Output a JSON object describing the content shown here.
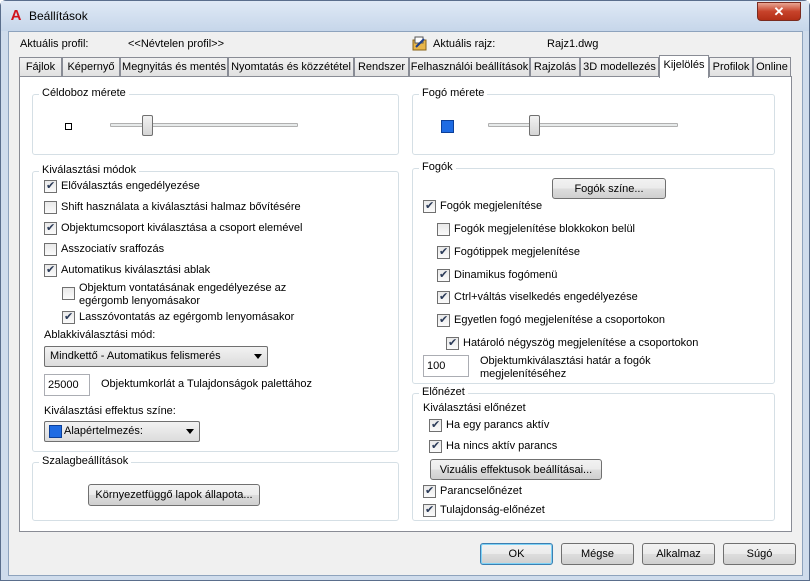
{
  "window": {
    "title": "Beállítások",
    "close_glyph": "✕",
    "app_icon_letter": "A"
  },
  "profile": {
    "label": "Aktuális profil:",
    "value": "<<Névtelen profil>>"
  },
  "drawing": {
    "label": "Aktuális rajz:",
    "value": "Rajz1.dwg"
  },
  "tabs": [
    "Fájlok",
    "Képernyő",
    "Megnyitás és mentés",
    "Nyomtatás és közzététel",
    "Rendszer",
    "Felhasználói beállítások",
    "Rajzolás",
    "3D modellezés",
    "Kijelölés",
    "Profilok",
    "Online"
  ],
  "pickbox": {
    "title": "Céldoboz mérete",
    "slider_value": 0.18
  },
  "grip_size": {
    "title": "Fogó mérete",
    "slider_value": 0.23,
    "color": "#1e6be3"
  },
  "selection_modes": {
    "title": "Kiválasztási módok",
    "items": [
      {
        "label": "Előválasztás engedélyezése",
        "checked": true
      },
      {
        "label": "Shift használata a kiválasztási halmaz bővítésére",
        "checked": false
      },
      {
        "label": "Objektumcsoport kiválasztása a csoport elemével",
        "checked": true
      },
      {
        "label": "Asszociatív sraffozás",
        "checked": false
      },
      {
        "label": "Automatikus kiválasztási ablak",
        "checked": true
      }
    ],
    "sub_items": [
      {
        "label_line1": "Objektum vontatásának engedélyezése az",
        "label_line2": "egérgomb lenyomásakor",
        "checked": false
      },
      {
        "label": "Lasszóvontatás az egérgomb lenyomásakor",
        "checked": true
      }
    ],
    "window_method_label": "Ablakkiválasztási mód:",
    "window_method_value": "Mindkettő - Automatikus felismerés",
    "object_limit_value": "25000",
    "object_limit_label": "Objektumkorlát a Tulajdonságok palettához",
    "effect_color_label": "Kiválasztási effektus színe:",
    "effect_color_value": "Alapértelmezés:",
    "effect_color_swatch": "#1e6be3"
  },
  "ribbon": {
    "title": "Szalagbeállítások",
    "button": "Környezetfüggő lapok állapota..."
  },
  "grips": {
    "title": "Fogók",
    "color_button": "Fogók színe...",
    "items": [
      {
        "label": "Fogók megjelenítése",
        "checked": true,
        "level": 0
      },
      {
        "label": "Fogók megjelenítése blokkokon belül",
        "checked": false,
        "level": 1
      },
      {
        "label": "Fogótippek megjelenítése",
        "checked": true,
        "level": 1
      },
      {
        "label": "Dinamikus fogómenü",
        "checked": true,
        "level": 1
      },
      {
        "label": "Ctrl+váltás viselkedés engedélyezése",
        "checked": true,
        "level": 1
      },
      {
        "label": "Egyetlen fogó megjelenítése a csoportokon",
        "checked": true,
        "level": 1
      },
      {
        "label": "Határoló négyszög megjelenítése a csoportokon",
        "checked": true,
        "level": 2
      }
    ],
    "limit_value": "100",
    "limit_label_line1": "Objektumkiválasztási határ a fogók",
    "limit_label_line2": "megjelenítéséhez"
  },
  "preview": {
    "title": "Előnézet",
    "subtitle": "Kiválasztási előnézet",
    "items": [
      {
        "label": "Ha egy parancs aktív",
        "checked": true
      },
      {
        "label": "Ha nincs aktív parancs",
        "checked": true
      }
    ],
    "visual_button": "Vizuális effektusok beállításai...",
    "items2": [
      {
        "label": "Parancselőnézet",
        "checked": true
      },
      {
        "label": "Tulajdonság-előnézet",
        "checked": true
      }
    ]
  },
  "footer": {
    "ok": "OK",
    "cancel": "Mégse",
    "apply": "Alkalmaz",
    "help": "Súgó"
  }
}
